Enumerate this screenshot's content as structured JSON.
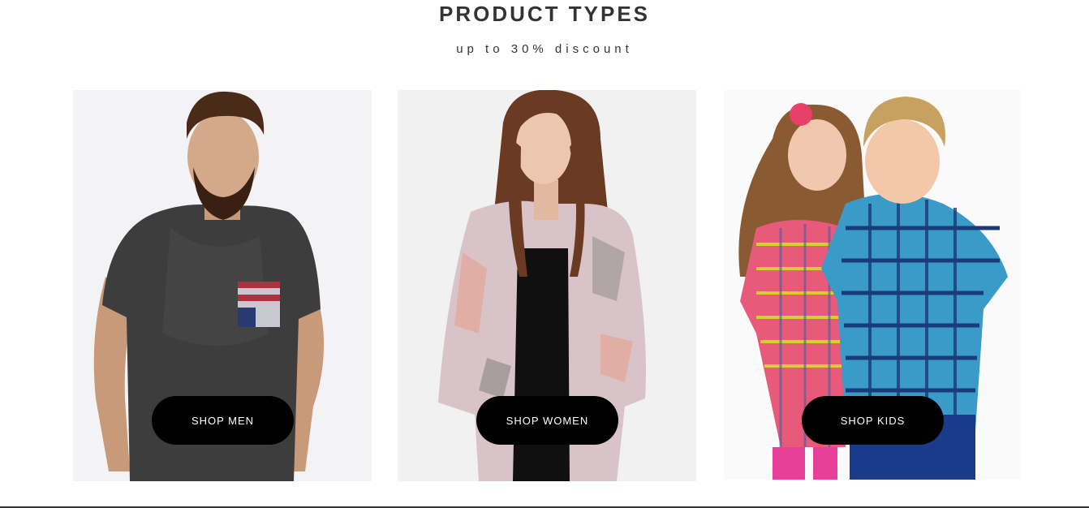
{
  "header": {
    "title": "PRODUCT TYPES",
    "subtitle": "up to 30% discount"
  },
  "cards": [
    {
      "id": "men",
      "button_label": "SHOP MEN"
    },
    {
      "id": "women",
      "button_label": "SHOP WOMEN"
    },
    {
      "id": "kids",
      "button_label": "SHOP KIDS"
    }
  ],
  "colors": {
    "button_bg": "#000000",
    "button_text": "#ffffff",
    "title_text": "#333333"
  }
}
